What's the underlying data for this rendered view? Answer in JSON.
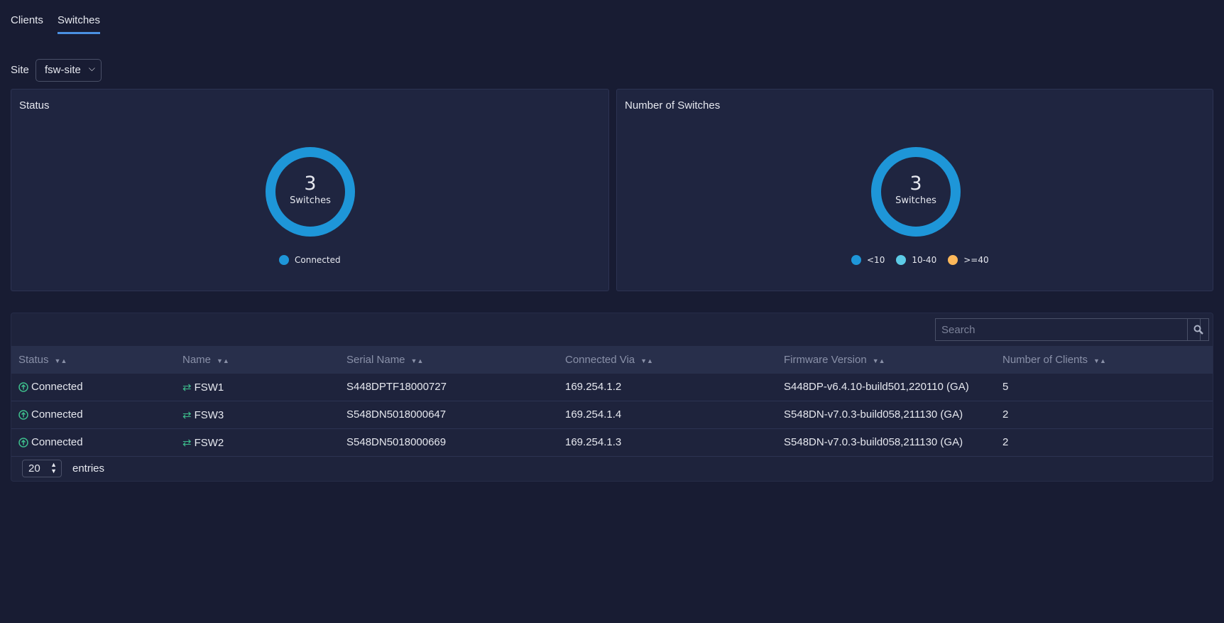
{
  "tabs": [
    {
      "label": "Clients",
      "active": false
    },
    {
      "label": "Switches",
      "active": true
    }
  ],
  "site": {
    "label": "Site",
    "value": "fsw-site"
  },
  "status_panel": {
    "title": "Status",
    "count": "3",
    "unit": "Switches",
    "legend": [
      {
        "label": "Connected",
        "color": "#1e96d8"
      }
    ]
  },
  "switches_panel": {
    "title": "Number of Switches",
    "count": "3",
    "unit": "Switches",
    "legend": [
      {
        "label": "<10",
        "color": "#1e96d8"
      },
      {
        "label": "10-40",
        "color": "#5ccbe6"
      },
      {
        "label": ">=40",
        "color": "#fdb85a"
      }
    ]
  },
  "table": {
    "search_placeholder": "Search",
    "columns": [
      "Status",
      "Name",
      "Serial Name",
      "Connected Via",
      "Firmware Version",
      "Number of Clients"
    ],
    "rows": [
      {
        "status": "Connected",
        "name": "FSW1",
        "serial": "S448DPTF18000727",
        "via": "169.254.1.2",
        "firmware": "S448DP-v6.4.10-build501,220110 (GA)",
        "clients": "5"
      },
      {
        "status": "Connected",
        "name": "FSW3",
        "serial": "S548DN5018000647",
        "via": "169.254.1.4",
        "firmware": "S548DN-v7.0.3-build058,211130 (GA)",
        "clients": "2"
      },
      {
        "status": "Connected",
        "name": "FSW2",
        "serial": "S548DN5018000669",
        "via": "169.254.1.3",
        "firmware": "S548DN-v7.0.3-build058,211130 (GA)",
        "clients": "2"
      }
    ],
    "page_size": "20",
    "entries_label": "entries"
  }
}
